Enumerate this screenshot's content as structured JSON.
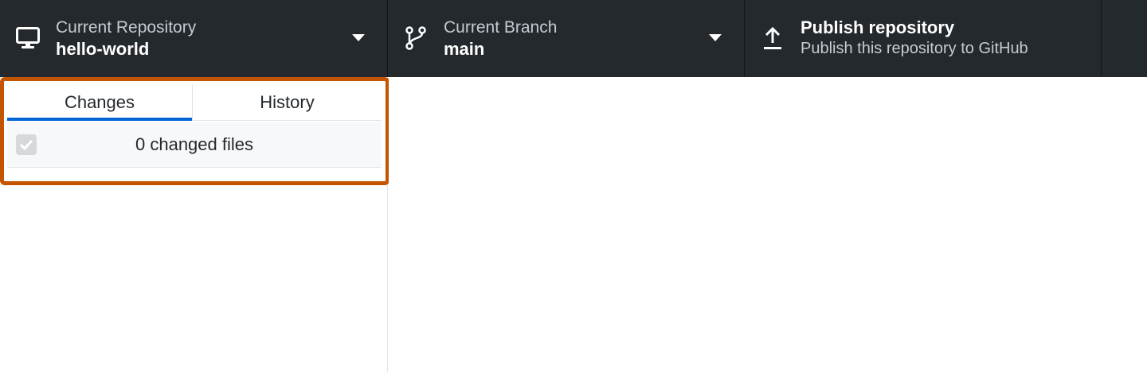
{
  "toolbar": {
    "repository": {
      "label": "Current Repository",
      "value": "hello-world",
      "icon": "desktop-icon"
    },
    "branch": {
      "label": "Current Branch",
      "value": "main",
      "icon": "git-branch-icon"
    },
    "publish": {
      "title": "Publish repository",
      "subtitle": "Publish this repository to GitHub",
      "icon": "upload-icon"
    }
  },
  "sidebar": {
    "tabs": [
      {
        "label": "Changes",
        "selected": true
      },
      {
        "label": "History",
        "selected": false
      }
    ],
    "changed_files_label": "0 changed files",
    "select_all_checked": true
  },
  "colors": {
    "toolbar_bg": "#24292e",
    "accent": "#0366d6",
    "highlight": "#c45500"
  }
}
